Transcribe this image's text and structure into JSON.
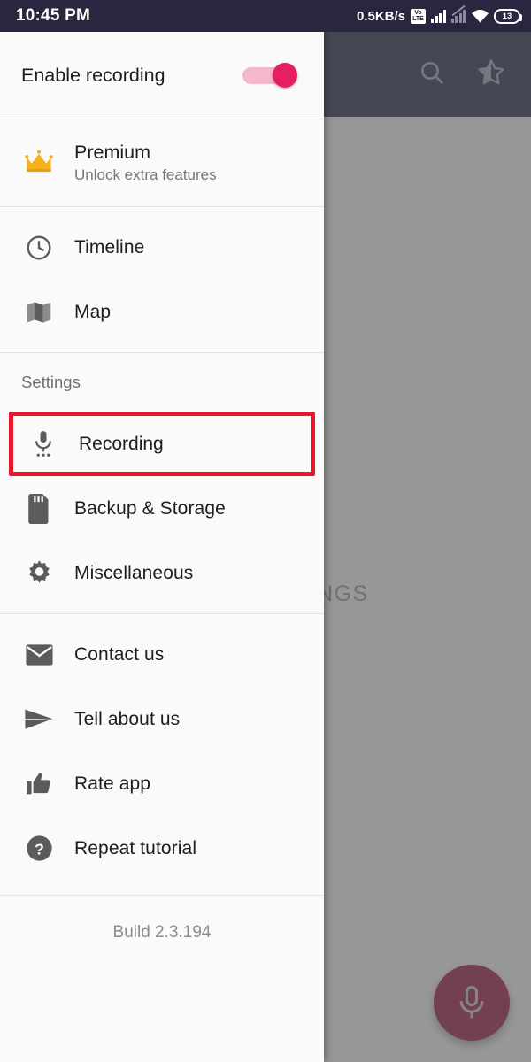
{
  "status_bar": {
    "clock": "10:45 PM",
    "net_speed": "0.5KB/s",
    "volte_top": "Vo",
    "volte_bottom": "LTE",
    "battery_level": "13",
    "icons": [
      "volte-icon",
      "signal-bars-icon",
      "signal-bars-off-icon",
      "wifi-icon",
      "battery-icon"
    ]
  },
  "app_bar": {
    "search_icon": "search-icon",
    "favorite_icon": "star-half-icon"
  },
  "background": {
    "empty_label": "NO RECORDINGS",
    "fab_icon": "microphone-icon"
  },
  "drawer": {
    "enable_recording": {
      "label": "Enable recording",
      "toggle_state": "on",
      "toggle_on_color": "#e51f62",
      "toggle_track_color": "#f3b8cd"
    },
    "premium": {
      "title": "Premium",
      "subtitle": "Unlock extra features",
      "icon": "crown-icon",
      "icon_color": "#f5b21d"
    },
    "nav_items": [
      {
        "label": "Timeline",
        "icon": "clock-icon"
      },
      {
        "label": "Map",
        "icon": "map-icon"
      }
    ],
    "settings_header": "Settings",
    "settings_items": [
      {
        "label": "Recording",
        "icon": "microphone-settings-icon",
        "highlighted": true,
        "highlight_color": "#e8172b"
      },
      {
        "label": "Backup & Storage",
        "icon": "sd-card-icon",
        "highlighted": false
      },
      {
        "label": "Miscellaneous",
        "icon": "gear-icon",
        "highlighted": false
      }
    ],
    "info_items": [
      {
        "label": "Contact us",
        "icon": "envelope-icon"
      },
      {
        "label": "Tell about us",
        "icon": "send-icon"
      },
      {
        "label": "Rate app",
        "icon": "thumb-up-icon"
      },
      {
        "label": "Repeat tutorial",
        "icon": "question-circle-icon"
      }
    ],
    "build": "Build 2.3.194"
  }
}
